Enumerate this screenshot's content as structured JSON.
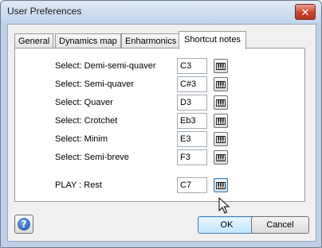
{
  "window": {
    "title": "User Preferences",
    "close_symbol": "✕"
  },
  "tabs": [
    {
      "label": "General",
      "active": false
    },
    {
      "label": "Dynamics map",
      "active": false
    },
    {
      "label": "Enharmonics",
      "active": false
    },
    {
      "label": "Shortcut notes",
      "active": true
    }
  ],
  "shortcuts": [
    {
      "label": "Select: Demi-semi-quaver",
      "value": "C3"
    },
    {
      "label": "Select: Semi-quaver",
      "value": "C#3"
    },
    {
      "label": "Select: Quaver",
      "value": "D3"
    },
    {
      "label": "Select: Crotchet",
      "value": "Eb3"
    },
    {
      "label": "Select: Minim",
      "value": "E3"
    },
    {
      "label": "Select: Semi-breve",
      "value": "F3"
    },
    {
      "label": "PLAY : Rest",
      "value": "C7"
    }
  ],
  "icons": {
    "piano": "piano-keyboard-icon",
    "help": "help-icon",
    "cursor": "mouse-pointer-icon"
  },
  "help": {
    "symbol": "?"
  },
  "buttons": {
    "ok": "OK",
    "cancel": "Cancel"
  }
}
